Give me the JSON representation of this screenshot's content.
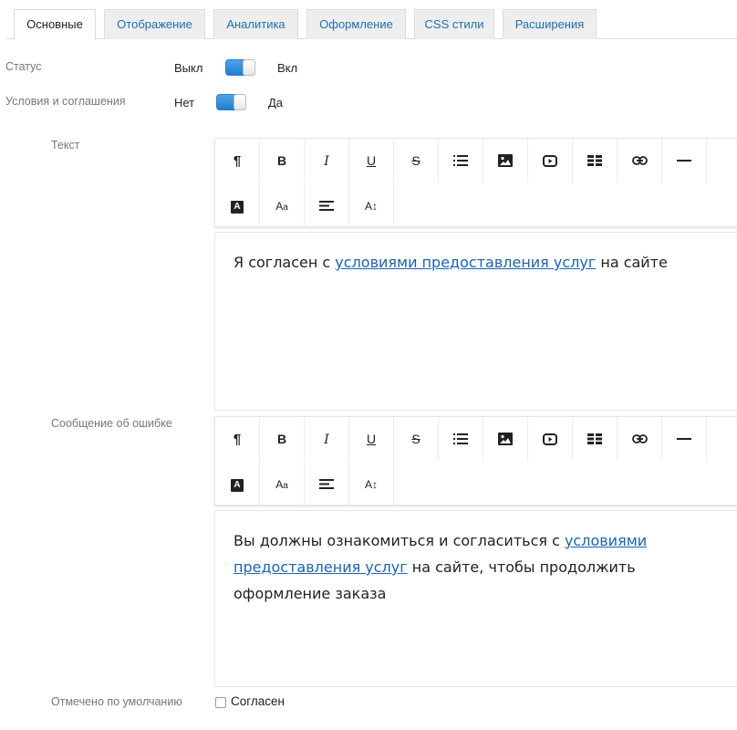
{
  "tabs": [
    {
      "label": "Основные",
      "active": true
    },
    {
      "label": "Отображение"
    },
    {
      "label": "Аналитика"
    },
    {
      "label": "Оформление"
    },
    {
      "label": "CSS стили"
    },
    {
      "label": "Расширения"
    }
  ],
  "status": {
    "label": "Статус",
    "off_label": "Выкл",
    "on_label": "Вкл",
    "value": "on"
  },
  "terms": {
    "label": "Условия и соглашения",
    "off_label": "Нет",
    "on_label": "Да",
    "value": "on"
  },
  "text_editor": {
    "label": "Текст",
    "content": {
      "before": "Я согласен с ",
      "link": "условиями предоставления услуг",
      "after": " на сайте"
    }
  },
  "error_editor": {
    "label": "Сообщение об ошибке",
    "content": {
      "before": "Вы должны ознакомиться и согласиться с ",
      "link": "условиями предоставления услуг",
      "after": " на сайте, чтобы продолжить оформление заказа"
    }
  },
  "toolbar_buttons": [
    {
      "name": "paragraph-icon",
      "glyph": "¶"
    },
    {
      "name": "bold-icon",
      "glyph": "B"
    },
    {
      "name": "italic-icon",
      "glyph": "I"
    },
    {
      "name": "underline-icon",
      "glyph": "U"
    },
    {
      "name": "strikethrough-icon",
      "glyph": "S"
    },
    {
      "name": "list-icon",
      "glyph": ""
    },
    {
      "name": "image-icon",
      "glyph": ""
    },
    {
      "name": "video-icon",
      "glyph": ""
    },
    {
      "name": "table-icon",
      "glyph": ""
    },
    {
      "name": "link-icon",
      "glyph": ""
    },
    {
      "name": "horizontal-line-icon",
      "glyph": ""
    },
    {
      "name": "text-color-icon",
      "glyph": "A"
    },
    {
      "name": "font-size-icon",
      "glyph": "Aa"
    },
    {
      "name": "align-icon",
      "glyph": ""
    },
    {
      "name": "line-height-icon",
      "glyph": "A↕"
    }
  ],
  "default_checked": {
    "label": "Отмечено по умолчанию",
    "checkbox_label": "Согласен",
    "checked": false
  },
  "colors": {
    "accent": "#1c7ed6",
    "link": "#1a63b8",
    "tab_text": "#1f6fb3"
  }
}
